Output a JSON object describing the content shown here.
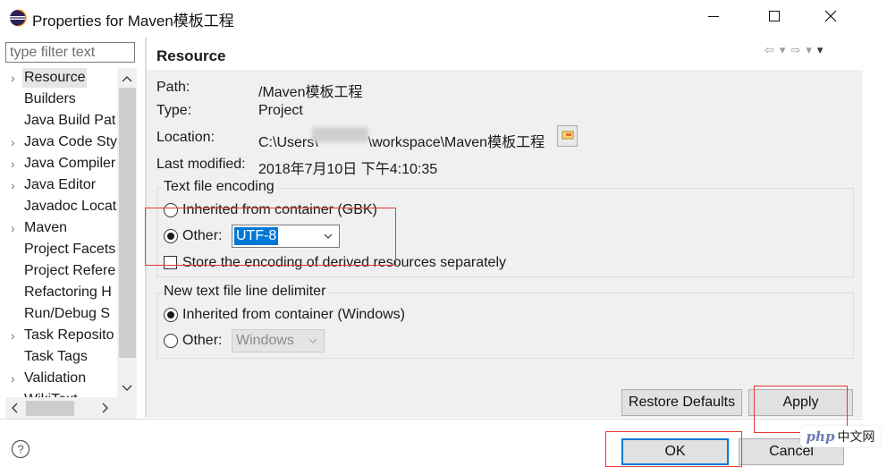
{
  "window": {
    "title": "Properties for Maven模板工程",
    "minimize_icon": "minimize-icon",
    "maximize_icon": "maximize-icon",
    "close_icon": "close-icon"
  },
  "filter": {
    "placeholder": "type filter text"
  },
  "tree": {
    "items": [
      {
        "label": "Resource",
        "expandable": true,
        "selected": true
      },
      {
        "label": "Builders",
        "expandable": false
      },
      {
        "label": "Java Build Pat",
        "expandable": false
      },
      {
        "label": "Java Code Sty",
        "expandable": true
      },
      {
        "label": "Java Compiler",
        "expandable": true
      },
      {
        "label": "Java Editor",
        "expandable": true
      },
      {
        "label": "Javadoc Locat",
        "expandable": false
      },
      {
        "label": "Maven",
        "expandable": true
      },
      {
        "label": "Project Facets",
        "expandable": false
      },
      {
        "label": "Project Refere",
        "expandable": false
      },
      {
        "label": "Refactoring H",
        "expandable": false
      },
      {
        "label": "Run/Debug S",
        "expandable": false
      },
      {
        "label": "Task Reposito",
        "expandable": true
      },
      {
        "label": "Task Tags",
        "expandable": false
      },
      {
        "label": "Validation",
        "expandable": true
      },
      {
        "label": "WikiText",
        "expandable": false
      }
    ]
  },
  "page": {
    "title": "Resource",
    "path_label": "Path:",
    "path_value": "/Maven模板工程",
    "type_label": "Type:",
    "type_value": "Project",
    "location_label": "Location:",
    "location_prefix": "C:\\Users\\",
    "location_suffix": "\\workspace\\Maven模板工程",
    "modified_label": "Last modified:",
    "modified_value": "2018年7月10日 下午4:10:35",
    "encoding": {
      "group_title": "Text file encoding",
      "inherited_label": "Inherited from container (GBK)",
      "other_label": "Other:",
      "other_value": "UTF-8",
      "selected": "other",
      "store_label": "Store the encoding of derived resources separately",
      "store_checked": false
    },
    "delimiter": {
      "group_title": "New text file line delimiter",
      "inherited_label": "Inherited from container (Windows)",
      "other_label": "Other:",
      "other_value": "Windows",
      "selected": "inherited"
    },
    "restore_label": "Restore Defaults",
    "apply_label": "Apply"
  },
  "footer": {
    "ok_label": "OK",
    "cancel_label": "Cancel",
    "help_icon": "help-icon"
  },
  "watermark": {
    "logo": "php",
    "text": "中文网"
  },
  "colors": {
    "accent": "#0078d7",
    "annotation": "#e53935",
    "dialog_bg": "#f0f0f0"
  }
}
